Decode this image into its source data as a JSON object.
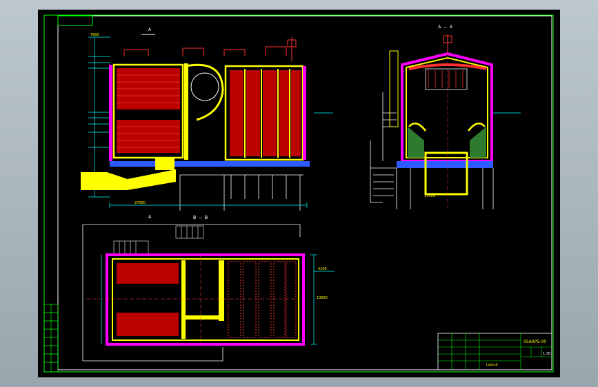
{
  "window": {
    "title": ""
  },
  "colors": {
    "bg": "#000000",
    "frame": "#00ff00",
    "wall": "#ffff00",
    "tube": "#ff3030",
    "refractory": "#ff00ff",
    "base": "#2d5bff",
    "dim": "#00ffff",
    "ink": "#ffffff",
    "center": "#ff4040"
  },
  "views": {
    "side_section": {
      "label": "A"
    },
    "end_section": {
      "label": "A — A"
    },
    "plan_section": {
      "label": "B — B"
    },
    "side_bottom": {
      "label": "A"
    }
  },
  "dimensions": {
    "top_left": "7800",
    "width_total": "27000",
    "end_width": "17000",
    "plan_height": "13600",
    "plan_right": "4100"
  },
  "title_block": {
    "drawing_no": "05AXPS-00",
    "scale": "1:30",
    "title": "Layout"
  }
}
